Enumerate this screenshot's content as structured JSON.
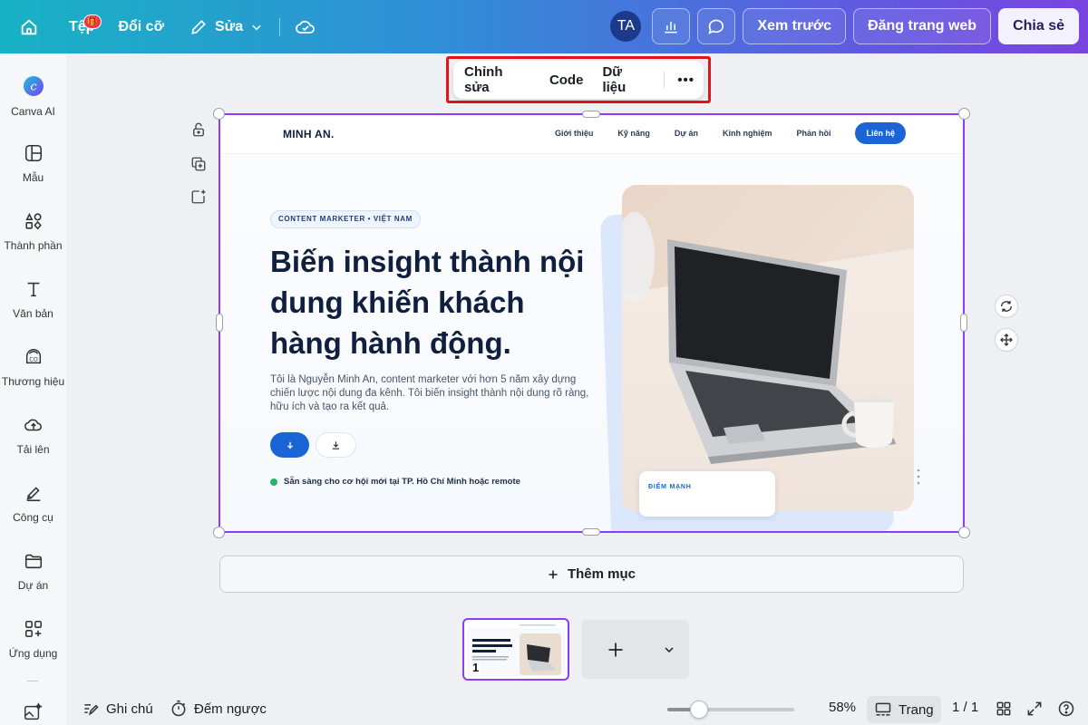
{
  "topbar": {
    "file_label": "Tệp",
    "file_badge": "🎁",
    "resize_label": "Đổi cỡ",
    "edit_label": "Sửa",
    "avatar_initials": "TA",
    "preview_label": "Xem trước",
    "publish_label": "Đăng trang web",
    "share_label": "Chia sẻ"
  },
  "sidebar": {
    "items": [
      {
        "label": "Canva AI",
        "icon": "canva-ai-icon"
      },
      {
        "label": "Mẫu",
        "icon": "templates-icon"
      },
      {
        "label": "Thành phần",
        "icon": "elements-icon"
      },
      {
        "label": "Văn bản",
        "icon": "text-icon"
      },
      {
        "label": "Thương hiệu",
        "icon": "brand-icon"
      },
      {
        "label": "Tải lên",
        "icon": "upload-icon"
      },
      {
        "label": "Công cụ",
        "icon": "tools-icon"
      },
      {
        "label": "Dự án",
        "icon": "projects-icon"
      },
      {
        "label": "Ứng dụng",
        "icon": "apps-icon"
      }
    ]
  },
  "context_toolbar": {
    "edit_label": "Chỉnh sửa",
    "code_label": "Code",
    "data_label": "Dữ liệu",
    "more_label": "•••"
  },
  "design": {
    "logo": "MINH AN.",
    "nav_links": [
      "Giới thiệu",
      "Kỹ năng",
      "Dự án",
      "Kinh nghiệm",
      "Phản hồi"
    ],
    "nav_cta": "Liên hệ",
    "pill": "CONTENT MARKETER • VIỆT NAM",
    "headline": "Biến insight thành nội dung khiến khách hàng hành động.",
    "paragraph": "Tôi là Nguyễn Minh An, content marketer với hơn 5 năm xây dựng chiến lược nội dung đa kênh. Tôi biến insight thành nội dung rõ ràng, hữu ích và tạo ra kết quả.",
    "status": "Sẵn sàng cho cơ hội mới tại TP. Hồ Chí Minh hoặc remote",
    "card_label": "ĐIỂM MẠNH"
  },
  "add_section_label": "Thêm mục",
  "thumbnail": {
    "page_number": "1"
  },
  "bottombar": {
    "notes_label": "Ghi chú",
    "timer_label": "Đếm ngược",
    "zoom_value": 58,
    "zoom_label": "58%",
    "pages_label": "Trang",
    "page_counter": "1 / 1"
  },
  "colors": {
    "accent_purple": "#8b3dff",
    "highlight_red": "#e4121b",
    "design_blue": "#1a64d6",
    "status_green": "#24b36b"
  }
}
